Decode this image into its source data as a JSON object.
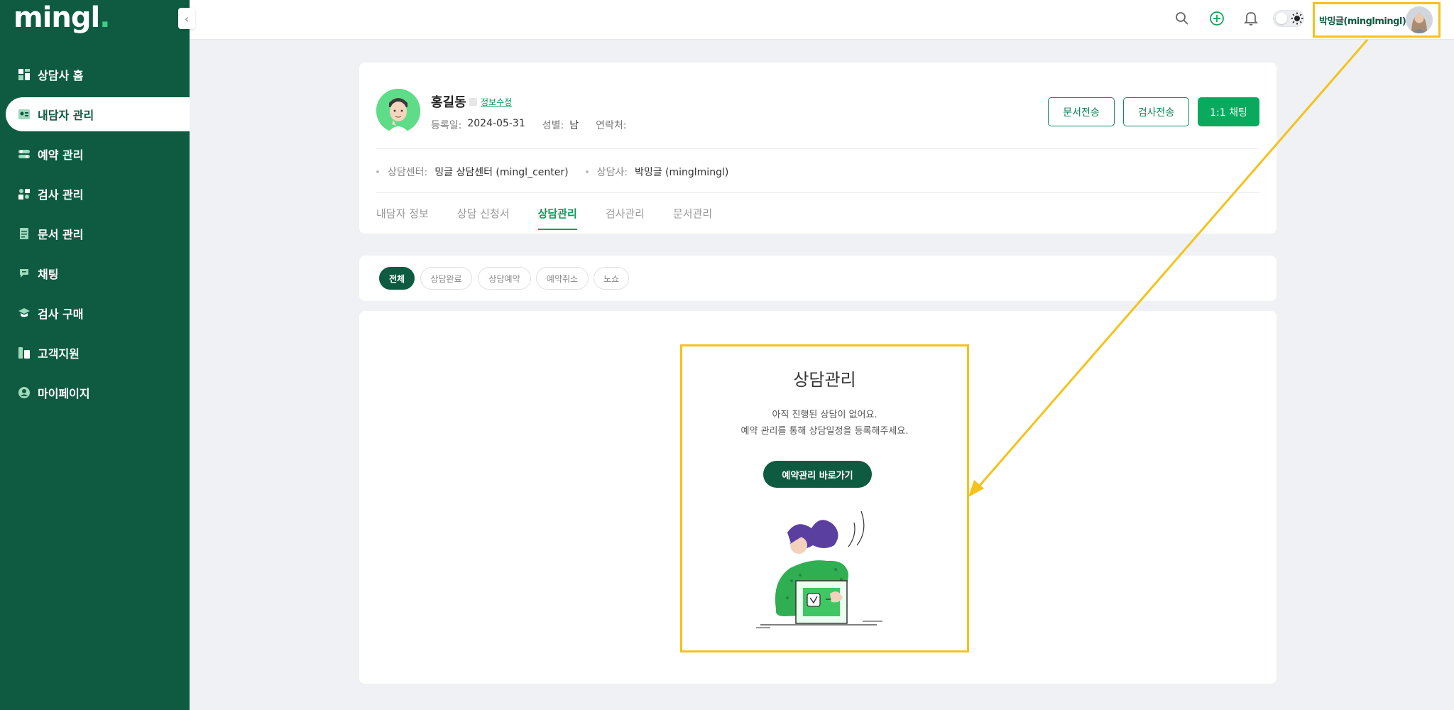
{
  "sidebar": {
    "logo": "mingl",
    "logo_dot": ".",
    "collapse_icon": "chevron-left-icon",
    "items": [
      {
        "label": "상담사 홈",
        "icon": "dashboard-icon"
      },
      {
        "label": "내담자 관리",
        "icon": "client-card-icon"
      },
      {
        "label": "예약 관리",
        "icon": "toggle-icon"
      },
      {
        "label": "검사 관리",
        "icon": "test-icon"
      },
      {
        "label": "문서 관리",
        "icon": "document-icon"
      },
      {
        "label": "채팅",
        "icon": "chat-icon"
      },
      {
        "label": "검사 구매",
        "icon": "purchase-icon"
      },
      {
        "label": "고객지원",
        "icon": "support-icon"
      },
      {
        "label": "마이페이지",
        "icon": "user-icon"
      }
    ],
    "active_index": 1
  },
  "topbar": {
    "icons": [
      "search-icon",
      "add-circle-icon",
      "bell-icon",
      "theme-toggle",
      "sun-icon"
    ],
    "user_name": "박밍글(minglmingl)"
  },
  "profile": {
    "name": "홍길동",
    "edit_label": "정보수정",
    "reg_label": "등록일:",
    "reg_value": "2024-05-31",
    "gender_label": "성별:",
    "gender_value": "남",
    "contact_label": "연락처:",
    "contact_value": "",
    "center_label": "상담센터:",
    "center_value": "밍글 상담센터 (mingl_center)",
    "counselor_label": "상담사:",
    "counselor_value": "박밍글 (minglmingl)",
    "buttons": {
      "send_doc": "문서전송",
      "send_test": "검사전송",
      "chat": "1:1 채팅"
    },
    "tabs": [
      "내담자 정보",
      "상담 신청서",
      "상담관리",
      "검사관리",
      "문서관리"
    ],
    "active_tab": 2
  },
  "filters": {
    "chips": [
      "전체",
      "상담완료",
      "상담예약",
      "예약취소",
      "노쇼"
    ],
    "active": 0
  },
  "empty_state": {
    "title": "상담관리",
    "line1": "아직 진행된 상담이 없어요.",
    "line2": "예약 관리를 통해 상담일정을 등록해주세요.",
    "cta": "예약관리 바로가기"
  },
  "colors": {
    "sidebar": "#0e5b41",
    "accent": "#0aaa5e",
    "highlight": "#f5c21b"
  }
}
